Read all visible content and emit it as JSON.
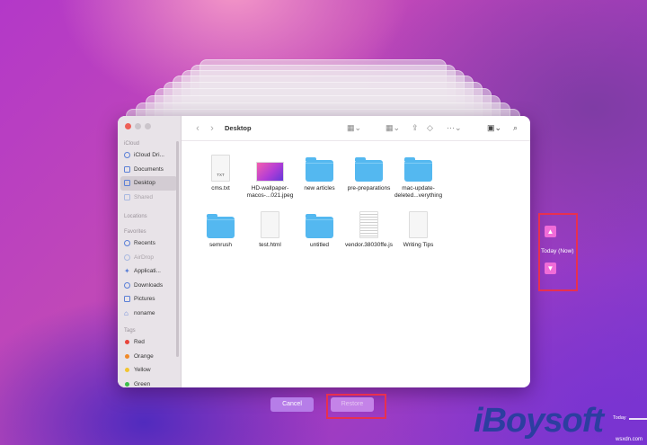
{
  "finder": {
    "title": "Desktop",
    "sidebar": {
      "icloud_heading": "iCloud",
      "icloud_items": [
        {
          "label": "iCloud Dri...",
          "icon": "cloud-icon",
          "state": "normal"
        },
        {
          "label": "Documents",
          "icon": "document-icon",
          "state": "normal"
        },
        {
          "label": "Desktop",
          "icon": "desktop-icon",
          "state": "selected"
        },
        {
          "label": "Shared",
          "icon": "shared-folder-icon",
          "state": "dimmed"
        }
      ],
      "locations_heading": "Locations",
      "favorites_heading": "Favorites",
      "favorite_items": [
        {
          "label": "Recents",
          "icon": "clock-icon",
          "state": "normal"
        },
        {
          "label": "AirDrop",
          "icon": "airdrop-icon",
          "state": "dimmed"
        },
        {
          "label": "Applicati...",
          "icon": "applications-icon",
          "state": "normal"
        },
        {
          "label": "Downloads",
          "icon": "download-icon",
          "state": "normal"
        },
        {
          "label": "Pictures",
          "icon": "pictures-icon",
          "state": "normal"
        },
        {
          "label": "noname",
          "icon": "home-icon",
          "state": "normal"
        }
      ],
      "tags_heading": "Tags",
      "tags": [
        {
          "label": "Red",
          "color": "#e8453c"
        },
        {
          "label": "Orange",
          "color": "#f0892a"
        },
        {
          "label": "Yellow",
          "color": "#f2c531"
        },
        {
          "label": "Green",
          "color": "#3cbf4a"
        }
      ]
    },
    "files": [
      {
        "name": "cms.txt",
        "kind": "txt-doc",
        "badge": "TXT"
      },
      {
        "name": "HD-wallpaper-macos-...021.jpeg",
        "kind": "image"
      },
      {
        "name": "new articles",
        "kind": "folder"
      },
      {
        "name": "pre-preparations",
        "kind": "folder"
      },
      {
        "name": "mac-update-deleted...verything",
        "kind": "folder"
      },
      {
        "name": "semrush",
        "kind": "folder"
      },
      {
        "name": "test.html",
        "kind": "doc"
      },
      {
        "name": "untitled",
        "kind": "folder"
      },
      {
        "name": "vendor.38030ffe.js",
        "kind": "js-doc"
      },
      {
        "name": "Writing Tips",
        "kind": "doc"
      }
    ]
  },
  "time_machine": {
    "current_label": "Today (Now)",
    "cancel_label": "Cancel",
    "restore_label": "Restore",
    "timeline_label": "Today",
    "accent_color": "#f06cd8",
    "highlight_color": "#e8304f"
  },
  "brand": {
    "text": "iBoysoft"
  },
  "watermark": {
    "text": "wsxdn.com"
  }
}
